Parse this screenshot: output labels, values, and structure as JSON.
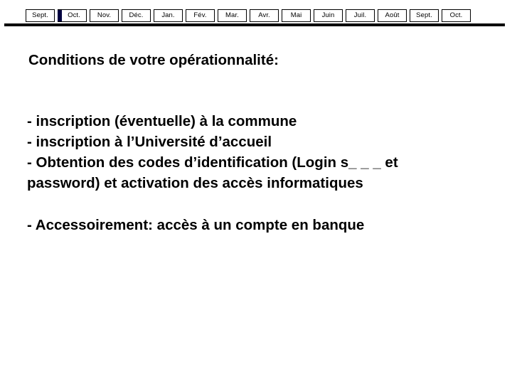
{
  "timeline": {
    "name": "academic-year-month-timeline",
    "current_month": "Oct.",
    "current_month_index": 1,
    "months": [
      {
        "label": "Sept."
      },
      {
        "label": "Oct."
      },
      {
        "label": "Nov."
      },
      {
        "label": "Déc."
      },
      {
        "label": "Jan."
      },
      {
        "label": "Fév."
      },
      {
        "label": "Mar."
      },
      {
        "label": "Avr."
      },
      {
        "label": "Mai"
      },
      {
        "label": "Juin"
      },
      {
        "label": "Juil."
      },
      {
        "label": "Août"
      },
      {
        "label": "Sept."
      },
      {
        "label": "Oct."
      }
    ]
  },
  "slide": {
    "heading": "Conditions de votre opérationnalité:",
    "bullets_primary": [
      "- inscription (éventuelle) à la commune",
      "- inscription à l’Université d’accueil",
      "- Obtention des codes d’identification (Login s_ _ _ et",
      "password) et activation des accès informatiques"
    ],
    "bullets_secondary": [
      "- Accessoirement: accès à un compte en banque"
    ]
  },
  "colors": {
    "background": "#ffffff",
    "text": "#000000",
    "rule": "#000000",
    "current_marker": "#000040",
    "tab_border": "#000000",
    "tab_fill": "#ffffff"
  }
}
